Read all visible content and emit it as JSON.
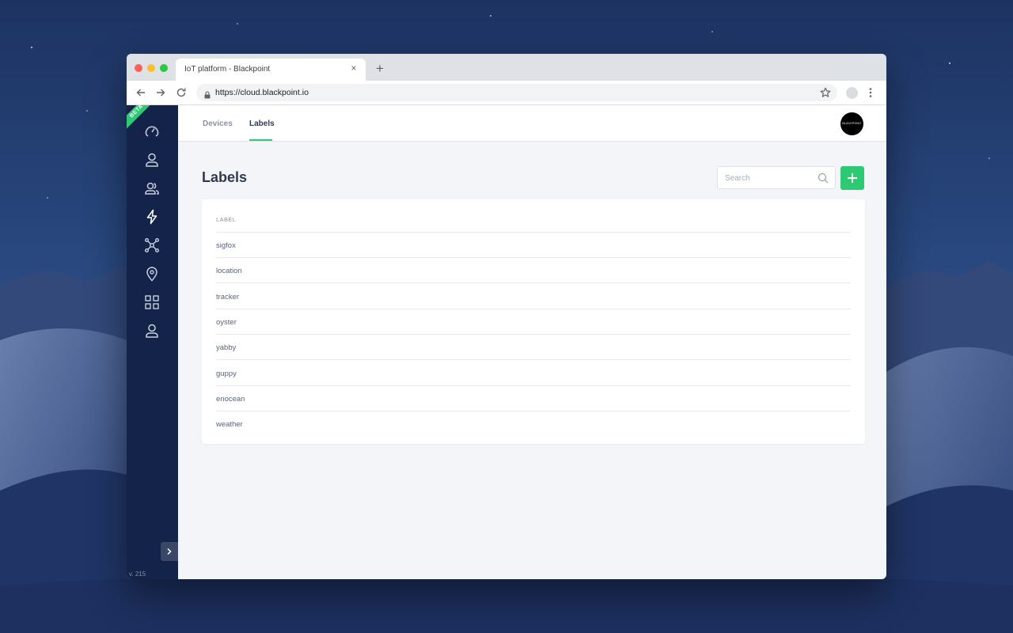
{
  "browser": {
    "tab_title": "IoT platform - Blackpoint",
    "url": "https://cloud.blackpoint.io"
  },
  "sidebar": {
    "ribbon": "BETA",
    "icons": [
      "dashboard-icon",
      "user-icon",
      "users-icon",
      "lightning-icon",
      "network-icon",
      "location-pin-icon",
      "grid-icon",
      "account-icon"
    ],
    "version": "v. 215"
  },
  "topnav": {
    "tabs": [
      {
        "label": "Devices",
        "active": false
      },
      {
        "label": "Labels",
        "active": true
      }
    ],
    "avatar_text": "BLACKPOINT"
  },
  "page": {
    "title": "Labels",
    "search_placeholder": "Search"
  },
  "table": {
    "column_header": "LABEL",
    "rows": [
      "sigfox",
      "location",
      "tracker",
      "oyster",
      "yabby",
      "guppy",
      "enocean",
      "weather"
    ]
  },
  "colors": {
    "accent": "#2dca73",
    "sidebar_bg": "#14234a",
    "page_bg": "#f4f5f8"
  }
}
